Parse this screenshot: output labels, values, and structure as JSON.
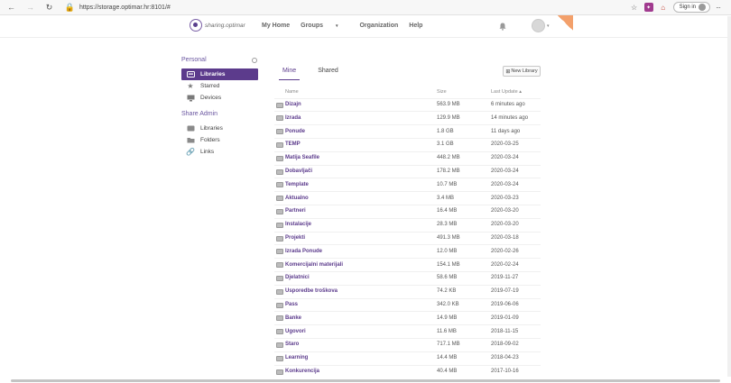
{
  "browser": {
    "url": "https://storage.optimar.hr:8101/#",
    "signin_label": "Sign in"
  },
  "app": {
    "logo_text": "sharing.optimar",
    "nav": [
      "My Home",
      "Groups",
      "Organization",
      "Help"
    ]
  },
  "sidebar": {
    "personal_label": "Personal",
    "personal_items": [
      "Libraries",
      "Starred",
      "Devices"
    ],
    "share_admin_label": "Share Admin",
    "share_admin_items": [
      "Libraries",
      "Folders",
      "Links"
    ]
  },
  "main": {
    "tabs": [
      "Mine",
      "Shared"
    ],
    "new_library_label": "New Library",
    "columns": {
      "name": "Name",
      "size": "Size",
      "last_update": "Last Update"
    },
    "rows": [
      {
        "name": "Dizajn",
        "size": "563.9 MB",
        "updated": "6 minutes ago"
      },
      {
        "name": "Izrada",
        "size": "129.9 MB",
        "updated": "14 minutes ago"
      },
      {
        "name": "Ponude",
        "size": "1.8 GB",
        "updated": "11 days ago"
      },
      {
        "name": "TEMP",
        "size": "3.1 GB",
        "updated": "2020-03-25"
      },
      {
        "name": "Matija Seafile",
        "size": "448.2 MB",
        "updated": "2020-03-24"
      },
      {
        "name": "Dobavljači",
        "size": "178.2 MB",
        "updated": "2020-03-24"
      },
      {
        "name": "Template",
        "size": "10.7 MB",
        "updated": "2020-03-24"
      },
      {
        "name": "Aktualno",
        "size": "3.4 MB",
        "updated": "2020-03-23"
      },
      {
        "name": "Partneri",
        "size": "16.4 MB",
        "updated": "2020-03-20"
      },
      {
        "name": "Instalacije",
        "size": "28.3 MB",
        "updated": "2020-03-20"
      },
      {
        "name": "Projekti",
        "size": "491.3 MB",
        "updated": "2020-03-18"
      },
      {
        "name": "Izrada Ponude",
        "size": "12.0 MB",
        "updated": "2020-02-26"
      },
      {
        "name": "Komercijalni materijali",
        "size": "154.1 MB",
        "updated": "2020-02-24"
      },
      {
        "name": "Djelatnici",
        "size": "58.6 MB",
        "updated": "2019-11-27"
      },
      {
        "name": "Usporedbe troškova",
        "size": "74.2 KB",
        "updated": "2019-07-19"
      },
      {
        "name": "Pass",
        "size": "342.0 KB",
        "updated": "2019-06-06"
      },
      {
        "name": "Banke",
        "size": "14.9 MB",
        "updated": "2019-01-09"
      },
      {
        "name": "Ugovori",
        "size": "11.6 MB",
        "updated": "2018-11-15"
      },
      {
        "name": "Staro",
        "size": "717.1 MB",
        "updated": "2018-09-02"
      },
      {
        "name": "Learning",
        "size": "14.4 MB",
        "updated": "2018-04-23"
      },
      {
        "name": "Konkurencija",
        "size": "40.4 MB",
        "updated": "2017-10-16"
      }
    ]
  },
  "colors": {
    "accent": "#5c3b8c",
    "brand_orange": "#f3a06b"
  }
}
